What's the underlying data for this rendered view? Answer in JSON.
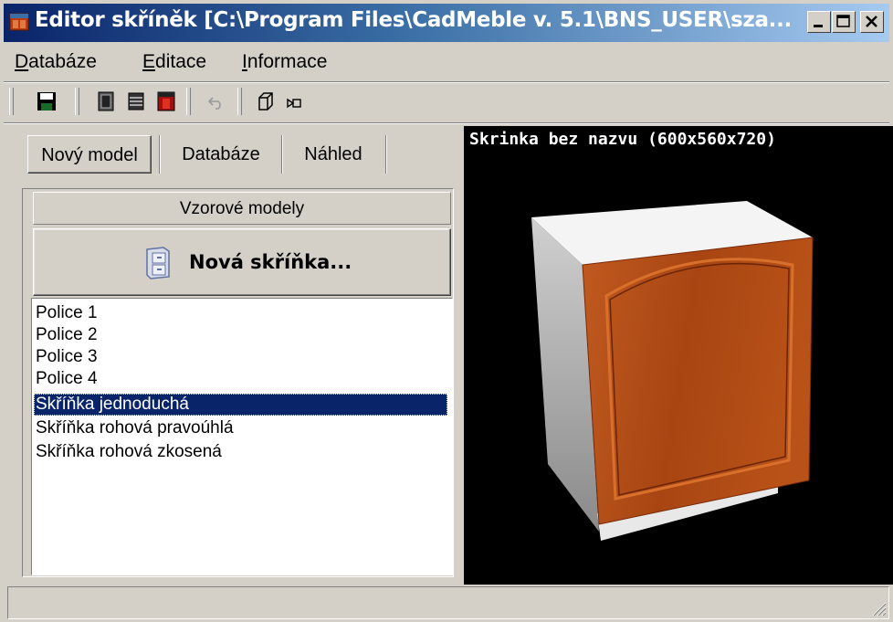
{
  "window": {
    "title": "Editor skříněk [C:\\Program Files\\CadMeble v. 5.1\\BNS_USER\\sza...",
    "controls": [
      "minimize-button",
      "maximize-button",
      "close-button"
    ]
  },
  "menu": {
    "items": [
      {
        "label": "Databáze",
        "underline": "D",
        "rest": "atabáze"
      },
      {
        "label": "Editace",
        "underline": "E",
        "rest": "ditace"
      },
      {
        "label": "Informace",
        "underline": "I",
        "rest": "nformace"
      }
    ]
  },
  "toolbar": {
    "buttons": [
      "save-icon",
      "cabinet-front-icon",
      "cabinet-shelves-icon",
      "cabinet-red-icon",
      "undo-icon",
      "box-3d-icon",
      "camera-icon"
    ]
  },
  "tabs": [
    {
      "label": "Nový model",
      "active": true
    },
    {
      "label": "Databáze",
      "active": false
    },
    {
      "label": "Náhled",
      "active": false
    }
  ],
  "section": {
    "header": "Vzorové modely",
    "new_button": "Nová skříňka..."
  },
  "list": {
    "items": [
      "Police 1",
      "Police 2",
      "Police 3",
      "Police 4",
      "Skříňka jednoduchá",
      "Skříňka rohová pravoúhlá",
      "Skříňka rohová zkosená"
    ],
    "selected": "Skříňka jednoduchá"
  },
  "preview": {
    "title": "Skrinka bez nazvu (600x560x720)"
  },
  "colors": {
    "title_start": "#0a246a",
    "title_end": "#a6caf0",
    "selection": "#0a246a",
    "door": "#b4521c",
    "face": "#d4d0c8"
  }
}
